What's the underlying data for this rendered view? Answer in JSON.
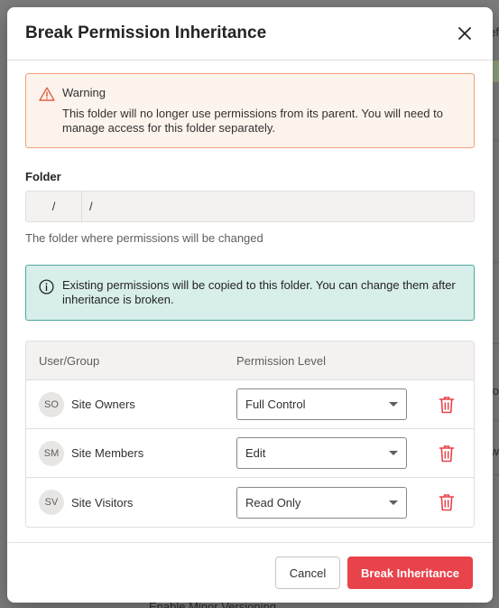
{
  "dialog": {
    "title": "Break Permission Inheritance",
    "close_icon": "close-icon"
  },
  "warning": {
    "icon": "warning-icon",
    "title": "Warning",
    "text": "This folder will no longer use permissions from its parent. You will need to manage access for this folder separately."
  },
  "folder": {
    "label": "Folder",
    "site_segment": "/",
    "path_segment": "/",
    "help": "The folder where permissions will be changed"
  },
  "info": {
    "icon": "info-icon",
    "text": "Existing permissions will be copied to this folder. You can change them after inheritance is broken."
  },
  "table": {
    "headers": [
      "User/Group",
      "Permission Level"
    ],
    "rows": [
      {
        "initials": "SO",
        "name": "Site Owners",
        "permission": "Full Control"
      },
      {
        "initials": "SM",
        "name": "Site Members",
        "permission": "Edit"
      },
      {
        "initials": "SV",
        "name": "Site Visitors",
        "permission": "Read Only"
      }
    ]
  },
  "footer": {
    "cancel_label": "Cancel",
    "confirm_label": "Break Inheritance"
  },
  "background": {
    "fragments": [
      "ef",
      "o",
      "w",
      "Enable Minor Versioning"
    ]
  },
  "colors": {
    "danger": "#e8424a",
    "warning_border": "#f0a47a",
    "info_border": "#4ea8a0"
  }
}
